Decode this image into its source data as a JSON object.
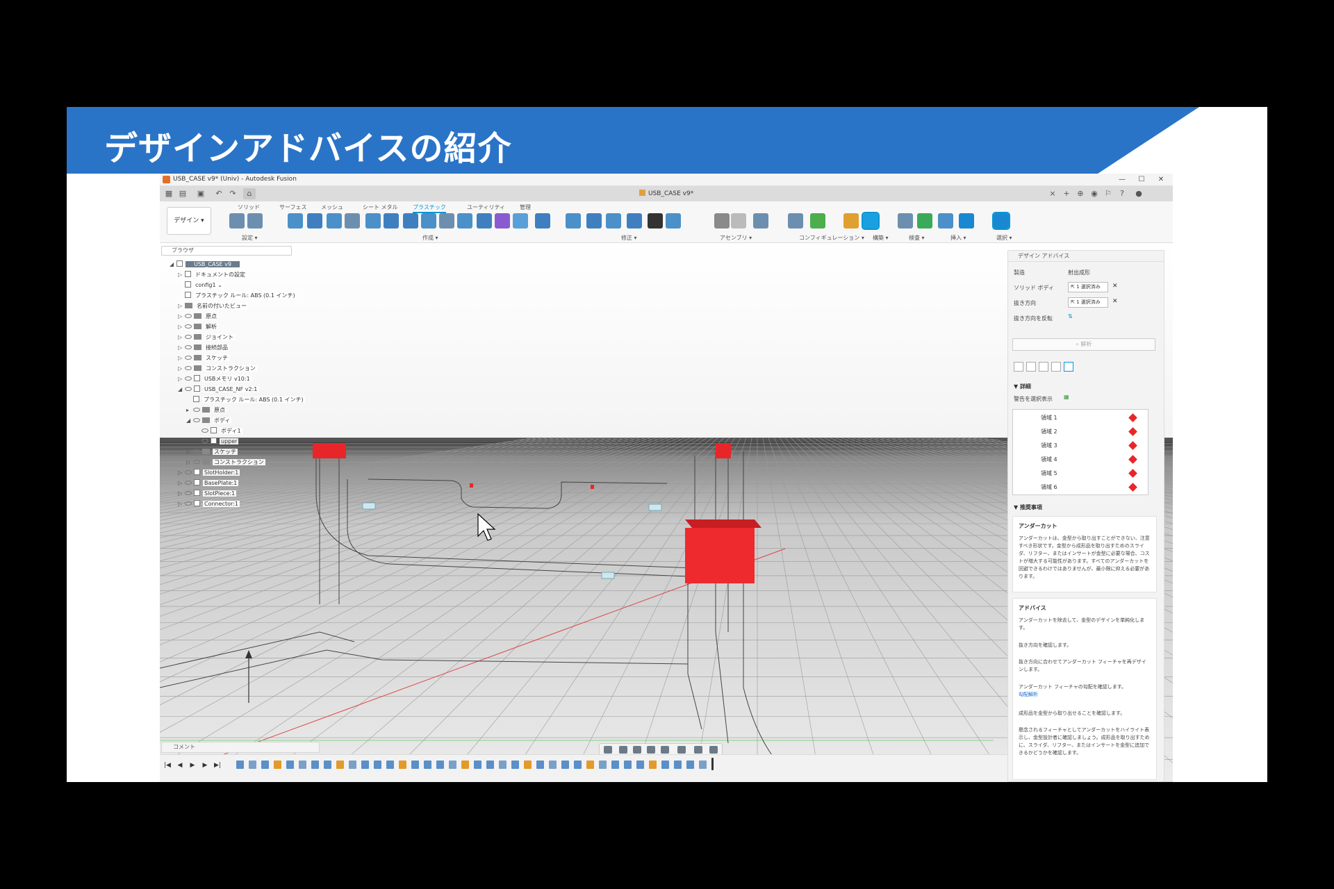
{
  "slide": {
    "title": "デザインアドバイスの紹介"
  },
  "window": {
    "title": "USB_CASE v9* (Univ) - Autodesk Fusion",
    "minimize": "—",
    "maximize": "☐",
    "close": "✕"
  },
  "doc_tab": {
    "label": "USB_CASE v9*",
    "close": "×"
  },
  "workspace": {
    "label": "デザイン ▾"
  },
  "ribbon_tabs": [
    "ソリッド",
    "サーフェス",
    "メッシュ",
    "シート メタル",
    "プラスチック",
    "ユーティリティ",
    "管理"
  ],
  "ribbon_active": "プラスチック",
  "tool_groups": [
    "設定 ▾",
    "作成 ▾",
    "修正 ▾",
    "アセンブリ ▾",
    "コンフィギュレーション ▾",
    "構築 ▾",
    "検査 ▾",
    "挿入 ▾",
    "選択 ▾"
  ],
  "browser": {
    "title": "ブラウザ",
    "items": [
      {
        "label": "USB_CASE v9",
        "level": 0,
        "root": true,
        "arrow": "◢"
      },
      {
        "label": "ドキュメントの設定",
        "level": 1,
        "arrow": "▷",
        "kind": "gear"
      },
      {
        "label": "config1 ⌄",
        "level": 1,
        "arrow": "",
        "kind": "comp"
      },
      {
        "label": "プラスチック ルール: ABS (0.1 インチ)",
        "level": 1,
        "arrow": "",
        "kind": "comp"
      },
      {
        "label": "名前の付いたビュー",
        "level": 1,
        "arrow": "▷",
        "kind": "folder"
      },
      {
        "label": "原点",
        "level": 1,
        "arrow": "▷",
        "kind": "folder",
        "eye": true
      },
      {
        "label": "解析",
        "level": 1,
        "arrow": "▷",
        "kind": "folder",
        "eye": true
      },
      {
        "label": "ジョイント",
        "level": 1,
        "arrow": "▷",
        "kind": "folder",
        "eye": true
      },
      {
        "label": "接続部品",
        "level": 1,
        "arrow": "▷",
        "kind": "folder",
        "eye": true
      },
      {
        "label": "スケッチ",
        "level": 1,
        "arrow": "▷",
        "kind": "folder",
        "eye": true
      },
      {
        "label": "コンストラクション",
        "level": 1,
        "arrow": "▷",
        "kind": "folder",
        "eye": true
      },
      {
        "label": "USBメモリ v10:1",
        "level": 1,
        "arrow": "▷",
        "kind": "comp",
        "eye": true
      },
      {
        "label": "USB_CASE_NF v2:1",
        "level": 1,
        "arrow": "◢",
        "kind": "comp",
        "eye": true
      },
      {
        "label": "プラスチック ルール: ABS (0.1 インチ)",
        "level": 2,
        "arrow": "",
        "kind": "comp"
      },
      {
        "label": "原点",
        "level": 2,
        "arrow": "▸",
        "kind": "folder",
        "eye": true
      },
      {
        "label": "ボディ",
        "level": 2,
        "arrow": "◢",
        "kind": "folder",
        "eye": true
      },
      {
        "label": "ボディ1",
        "level": 3,
        "arrow": "",
        "kind": "comp",
        "eye": true
      },
      {
        "label": "upper",
        "level": 3,
        "arrow": "",
        "kind": "comp",
        "eye": true
      },
      {
        "label": "スケッチ",
        "level": 2,
        "arrow": "▷",
        "kind": "folder",
        "eye": true
      },
      {
        "label": "コンストラクション",
        "level": 2,
        "arrow": "▷",
        "kind": "folder",
        "eye": true
      },
      {
        "label": "SlotHolder:1",
        "level": 1,
        "arrow": "▷",
        "kind": "comp",
        "eye": true
      },
      {
        "label": "BasePlate:1",
        "level": 1,
        "arrow": "▷",
        "kind": "comp",
        "eye": true
      },
      {
        "label": "SlotPiece:1",
        "level": 1,
        "arrow": "▷",
        "kind": "comp",
        "eye": true
      },
      {
        "label": "Connector:1",
        "level": 1,
        "arrow": "▷",
        "kind": "comp",
        "eye": true
      }
    ]
  },
  "comments": {
    "label": "コメント"
  },
  "timeline": {
    "controls": [
      "|◀",
      "◀",
      "▶",
      "▶",
      "▶|"
    ]
  },
  "panel": {
    "title": "デザイン アドバイス",
    "manufacturing_label": "製造",
    "manufacturing_value": "射出成形",
    "solid_body_label": "ソリッド ボディ",
    "solid_body_value": "1 選択済み",
    "pull_dir_label": "抜き方向",
    "pull_dir_value": "1 選択済み",
    "flip_label": "抜き方向を反転",
    "analyze_button": "解析",
    "details_title": "▼ 詳細",
    "show_all_label": "警告を選択表示",
    "areas": [
      "領域 1",
      "領域 2",
      "領域 3",
      "領域 4",
      "領域 5",
      "領域 6"
    ],
    "recommend_title": "▼ 推奨事項",
    "undercut_title": "アンダーカット",
    "undercut_body": "アンダーカットは、金型から取り出すことができない、注意すべき形状です。金型から成形品を取り出すためのスライダ、リフター、またはインサートが金型に必要な場合、コストが増大する可能性があります。すべてのアンダーカットを回避できるわけではありませんが、最小限に抑える必要があります。",
    "advice_title": "アドバイス",
    "advice_items": [
      "アンダーカットを除去して、金型のデザインを単純化します。",
      "抜き方向を確認します。",
      "抜き方向に合わせてアンダーカット フィーチャを再デザインします。",
      "アンダーカット フィーチャの勾配を確認します。",
      "成形品を金型から取り出せることを確認します。",
      "懸念されるフィーチャとしてアンダーカットをハイライト表示し、金型設計者に確認しましょう。成形品を取り出すために、スライダ、リフター、またはインサートを金型に追加できるかどうかを確認します。"
    ],
    "advice_link": "勾配解析"
  },
  "colors": {
    "banner": "#2a74c8",
    "accent": "#0696d7",
    "undercut_red": "#e8262a"
  }
}
